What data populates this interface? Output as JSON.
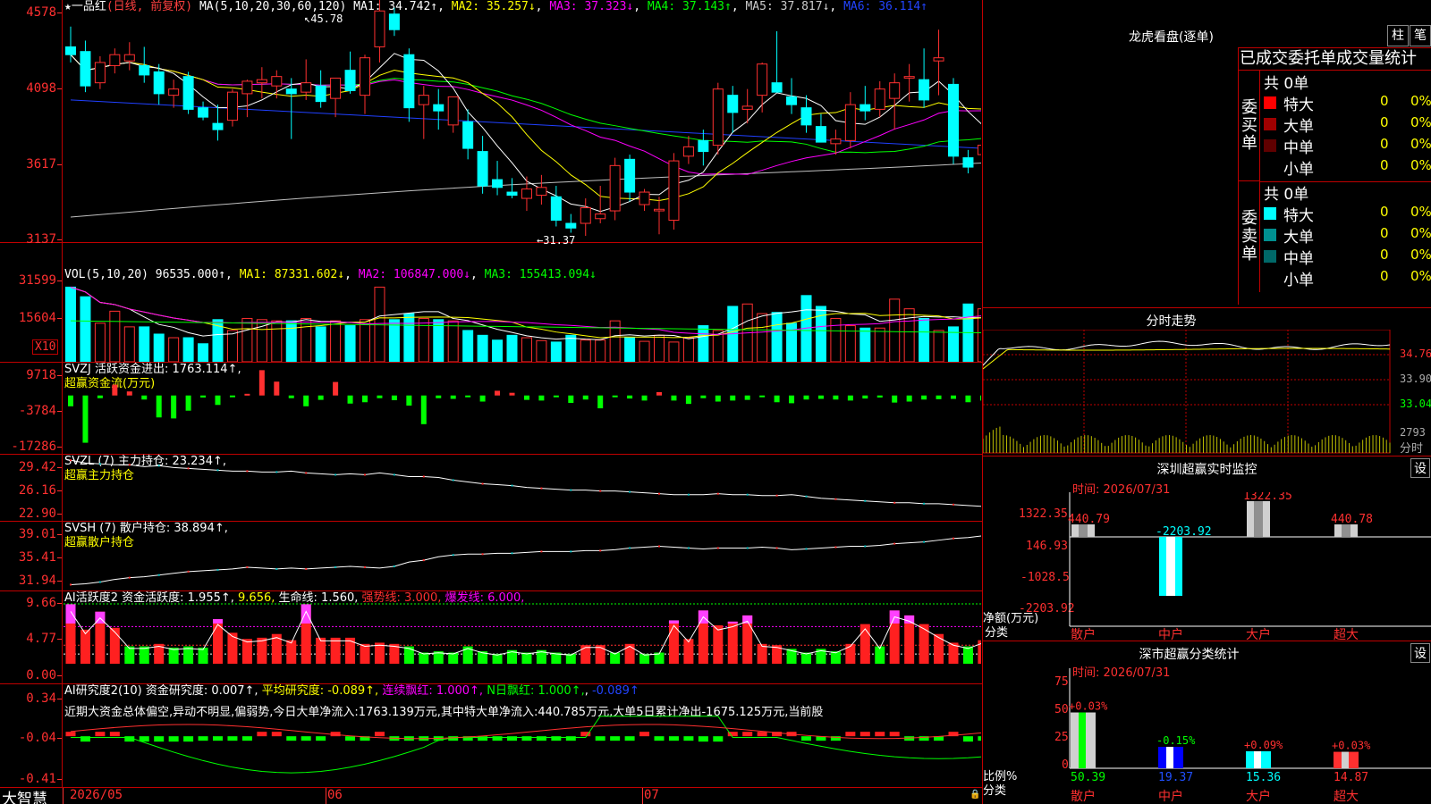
{
  "chart_header": {
    "title": "★一品红",
    "mode": "(日线, 前复权)",
    "ma_params": "MA(5,10,20,30,60,120)",
    "ma": [
      {
        "label": "MA1: 34.742↑",
        "color": "#ffffff"
      },
      {
        "label": "MA2: 35.257↓",
        "color": "#ffff00"
      },
      {
        "label": "MA3: 37.323↓",
        "color": "#ff00ff"
      },
      {
        "label": "MA4: 37.143↑",
        "color": "#00ff00"
      },
      {
        "label": "MA5: 37.817↓",
        "color": "#c0c0c0"
      },
      {
        "label": "MA6: 36.114↑",
        "color": "#0000ff"
      }
    ],
    "high_mark": "45.78",
    "low_mark": "←31.37"
  },
  "price_axis": [
    "4578",
    "4098",
    "3617",
    "3137"
  ],
  "vol_panel": {
    "header": "VOL(5,10,20)",
    "value": "96535.000↑",
    "ma1": "MA1: 87331.602↓",
    "ma2": "MA2: 106847.000↓",
    "ma3": "MA3: 155413.094↓",
    "axis": [
      "31599",
      "15604"
    ],
    "unit": "X10"
  },
  "svzj_panel": {
    "header": "SVZJ  活跃资金进出: 1763.114↑,",
    "sub": "超赢资金流(万元)",
    "axis": [
      "9718",
      "-3784",
      "-17286"
    ]
  },
  "svzl_panel": {
    "header": "SVZL (7) 主力持仓: 23.234↑,",
    "sub": "超赢主力持仓",
    "axis": [
      "29.42",
      "26.16",
      "22.90"
    ]
  },
  "svsh_panel": {
    "header": "SVSH (7) 散户持仓: 38.894↑,",
    "sub": "超赢散户持仓",
    "axis": [
      "39.01",
      "35.41",
      "31.94"
    ]
  },
  "ai_active_panel": {
    "header": "AI活跃度2 资金活跃度: 1.955↑,",
    "v2": "9.656,",
    "life": "生命线: 1.560,",
    "strong": "强势线: 3.000,",
    "burst": "爆发线: 6.000,",
    "axis": [
      "9.66",
      "4.77",
      "0.00"
    ]
  },
  "ai_research_panel": {
    "header": "AI研究度2(10) 资金研究度: 0.007↑,",
    "avg": "平均研究度: -0.089↑,",
    "cont": "连续飘红: 1.000↑,",
    "nday": "N日飘红: 1.000↑,",
    "neg": "-0.089↑",
    "axis": [
      "0.34",
      "-0.04",
      "-0.41"
    ],
    "note": "近期大资金总体偏空,异动不明显,偏弱势,今日大单净流入:1763.139万元,其中特大单净流入:440.785万元,大单5日累计净出-1675.125万元,当前股"
  },
  "xaxis": {
    "labels": [
      "2026/05",
      "06",
      "07"
    ],
    "brand": "大智慧"
  },
  "right": {
    "dragon_title": "龙虎看盘(逐单)",
    "btn_bar": "柱",
    "btn_pen": "笔",
    "tabs": "已成交委托单成交量统计",
    "buy_label": "委买单",
    "sell_label": "委卖单",
    "buy_total": "共 0单",
    "sell_total": "共 0单",
    "buy_rows": [
      {
        "name": "特大",
        "count": "0",
        "pct": "0%",
        "color": "#ff0000"
      },
      {
        "name": "大单",
        "count": "0",
        "pct": "0%",
        "color": "#a00000"
      },
      {
        "name": "中单",
        "count": "0",
        "pct": "0%",
        "color": "#600000"
      },
      {
        "name": "小单",
        "count": "0",
        "pct": "0%",
        "color": "#000000"
      }
    ],
    "sell_rows": [
      {
        "name": "特大",
        "count": "0",
        "pct": "0%",
        "color": "#00ffff"
      },
      {
        "name": "大单",
        "count": "0",
        "pct": "0%",
        "color": "#009090"
      },
      {
        "name": "中单",
        "count": "0",
        "pct": "0%",
        "color": "#006868"
      },
      {
        "name": "小单",
        "count": "0",
        "pct": "0%",
        "color": "#000000"
      }
    ],
    "intraday_title": "分时走势",
    "intraday_axis": [
      "34.76",
      "33.90",
      "33.04",
      "2793",
      "分时"
    ],
    "sz_monitor": {
      "title": "深圳超赢实时监控",
      "settings": "设",
      "time": "时间: 2026/07/31",
      "axis": [
        "1322.35",
        "146.93",
        "-1028.5",
        "-2203.92"
      ],
      "ylabel": "净额(万元)",
      "xlabel": "分类",
      "bars": [
        {
          "name": "散户",
          "value": 440.79,
          "label": "440.79"
        },
        {
          "name": "中户",
          "value": -2203.92,
          "label": "-2203.92"
        },
        {
          "name": "大户",
          "value": 1322.35,
          "label": "1322.35"
        },
        {
          "name": "超大",
          "value": 440.78,
          "label": "440.78"
        }
      ]
    },
    "sz_classify": {
      "title": "深市超赢分类统计",
      "settings": "设",
      "time": "时间: 2026/07/31",
      "axis": [
        "75",
        "50",
        "25",
        "0"
      ],
      "ylabel": "比例%",
      "xlabel": "分类",
      "bars": [
        {
          "name": "散户",
          "value": 50.39,
          "label": "50.39",
          "change": "+0.03%"
        },
        {
          "name": "中户",
          "value": 19.37,
          "label": "19.37",
          "change": "-0.15%"
        },
        {
          "name": "大户",
          "value": 15.36,
          "label": "15.36",
          "change": "+0.09%"
        },
        {
          "name": "超大",
          "value": 14.87,
          "label": "14.87",
          "change": "+0.03%"
        }
      ]
    }
  },
  "chart_data": [
    {
      "type": "candlestick",
      "title": "一品红 日线 前复权",
      "ylim": [
        31.0,
        46.5
      ],
      "candles": [
        [
          43.5,
          44.8,
          42.5,
          43.0
        ],
        [
          43.2,
          43.9,
          40.6,
          41.0
        ],
        [
          41.2,
          42.9,
          40.8,
          42.5
        ],
        [
          42.3,
          43.4,
          41.8,
          43.0
        ],
        [
          42.6,
          43.8,
          42.0,
          43.0
        ],
        [
          42.3,
          43.5,
          41.2,
          41.7
        ],
        [
          41.9,
          42.4,
          39.8,
          40.5
        ],
        [
          40.4,
          41.4,
          39.6,
          40.8
        ],
        [
          41.6,
          41.9,
          39.2,
          39.5
        ],
        [
          39.6,
          40.0,
          38.8,
          39.0
        ],
        [
          38.6,
          39.8,
          37.5,
          38.2
        ],
        [
          38.8,
          40.8,
          38.4,
          40.6
        ],
        [
          40.5,
          41.4,
          39.0,
          41.3
        ],
        [
          41.2,
          42.2,
          40.2,
          41.4
        ],
        [
          41.0,
          42.0,
          40.2,
          41.6
        ],
        [
          40.8,
          41.5,
          37.6,
          40.5
        ],
        [
          40.6,
          42.7,
          40.1,
          41.2
        ],
        [
          41.0,
          42.0,
          39.6,
          40.0
        ],
        [
          40.2,
          41.5,
          39.0,
          41.5
        ],
        [
          42.0,
          43.2,
          40.5,
          40.7
        ],
        [
          40.4,
          43.0,
          39.2,
          42.8
        ],
        [
          43.5,
          46.6,
          42.5,
          45.8
        ],
        [
          45.6,
          46.0,
          44.2,
          44.6
        ],
        [
          43.0,
          43.4,
          38.7,
          39.6
        ],
        [
          39.8,
          41.0,
          37.6,
          40.4
        ],
        [
          39.8,
          40.8,
          38.2,
          39.4
        ],
        [
          38.5,
          40.2,
          38.0,
          40.3
        ],
        [
          38.7,
          39.5,
          36.3,
          37.0
        ],
        [
          36.8,
          37.8,
          34.1,
          34.6
        ],
        [
          35.0,
          36.2,
          34.0,
          34.5
        ],
        [
          34.2,
          35.1,
          33.8,
          34.0
        ],
        [
          33.8,
          35.2,
          33.0,
          34.4
        ],
        [
          34.0,
          35.3,
          33.4,
          34.5
        ],
        [
          33.9,
          34.6,
          32.0,
          32.4
        ],
        [
          32.2,
          32.8,
          31.6,
          31.9
        ],
        [
          32.2,
          33.8,
          31.4,
          33.2
        ],
        [
          32.5,
          34.6,
          32.2,
          32.8
        ],
        [
          33.0,
          36.4,
          32.4,
          35.9
        ],
        [
          36.3,
          36.6,
          33.6,
          34.2
        ],
        [
          33.4,
          34.4,
          33.0,
          34.2
        ],
        [
          33.0,
          33.9,
          31.5,
          33.1
        ],
        [
          32.4,
          36.7,
          31.8,
          36.2
        ],
        [
          36.5,
          37.8,
          36.0,
          37.1
        ],
        [
          37.5,
          38.2,
          35.9,
          36.8
        ],
        [
          37.2,
          41.2,
          36.6,
          40.8
        ],
        [
          40.4,
          41.0,
          38.0,
          39.3
        ],
        [
          39.5,
          40.8,
          38.6,
          39.7
        ],
        [
          40.4,
          42.5,
          39.3,
          42.4
        ],
        [
          41.2,
          44.5,
          41.0,
          40.6
        ],
        [
          40.3,
          41.5,
          39.2,
          39.8
        ],
        [
          39.6,
          40.4,
          38.0,
          38.5
        ],
        [
          38.4,
          39.2,
          37.7,
          37.4
        ],
        [
          37.3,
          38.2,
          36.6,
          37.6
        ],
        [
          37.5,
          40.6,
          37.0,
          39.8
        ],
        [
          39.8,
          41.0,
          38.8,
          39.4
        ],
        [
          39.5,
          41.3,
          39.0,
          40.8
        ],
        [
          40.2,
          41.8,
          38.2,
          41.2
        ],
        [
          41.5,
          42.4,
          40.0,
          41.6
        ],
        [
          41.4,
          43.4,
          39.6,
          40.1
        ],
        [
          42.6,
          44.6,
          40.4,
          42.8
        ],
        [
          41.1,
          41.5,
          36.0,
          36.5
        ],
        [
          36.4,
          36.9,
          35.4,
          35.8
        ],
        [
          36.6,
          37.4,
          34.5,
          37.2
        ],
        [
          36.4,
          37.5,
          35.8,
          36.8
        ],
        [
          36.0,
          36.4,
          35.6,
          36.2
        ],
        [
          35.8,
          36.6,
          34.6,
          34.8
        ],
        [
          35.4,
          35.8,
          33.6,
          33.3
        ],
        [
          33.4,
          35.0,
          33.1,
          34.8
        ],
        [
          34.5,
          34.9,
          33.8,
          34.0
        ],
        [
          34.6,
          35.1,
          34.1,
          34.6
        ],
        [
          34.4,
          34.6,
          33.2,
          33.5
        ],
        [
          34.1,
          35.6,
          33.3,
          35.2
        ]
      ]
    },
    {
      "type": "bar",
      "title": "VOL",
      "unit": "X10",
      "values": [
        31000,
        27000,
        16000,
        21000,
        14500,
        14500,
        11500,
        10000,
        10000,
        7500,
        17500,
        13000,
        18000,
        17500,
        17000,
        17000,
        18000,
        14500,
        17000,
        15000,
        17500,
        31000,
        17500,
        20000,
        18000,
        17500,
        17000,
        13000,
        11000,
        9000,
        11000,
        10000,
        8800,
        8200,
        11000,
        9000,
        9000,
        17000,
        10000,
        8500,
        11000,
        8200,
        10000,
        15000,
        13000,
        23000,
        24000,
        20000,
        20500,
        16000,
        27500,
        23000,
        18000,
        15000,
        14000,
        14000,
        26000,
        22000,
        18000,
        13000,
        14500,
        24000,
        22000,
        24500,
        13000,
        10000,
        8000,
        9000,
        10000,
        10000,
        8000,
        8000
      ]
    },
    {
      "type": "bar",
      "title": "超赢资金流(万元)",
      "ylim": [
        -17286,
        9718
      ],
      "values": [
        -3200,
        -14000,
        -800,
        3200,
        1200,
        -1200,
        -6500,
        -6800,
        -4500,
        -600,
        -2800,
        -500,
        500,
        7500,
        4100,
        -800,
        -3200,
        -1300,
        4000,
        -2400,
        -2000,
        -800,
        -1400,
        -3000,
        -8500,
        -800,
        -1000,
        -500,
        -1800,
        1400,
        800,
        -1300,
        -1500,
        -500,
        -2200,
        -1200,
        -3800,
        -500,
        -900,
        -1500,
        1000,
        -1500,
        -2500,
        -800,
        -1800,
        -1500,
        -1300,
        -500,
        -2000,
        -2300,
        -1200,
        -1000,
        -1200,
        -1500,
        -900,
        -600,
        -2100,
        -1800,
        -1200,
        -1100,
        -1000,
        -2000,
        -1500,
        -900,
        -700,
        -1500,
        -1700,
        -1100,
        -1500,
        -1300,
        -2400,
        -1100
      ]
    },
    {
      "type": "line",
      "title": "超赢主力持仓",
      "ylim": [
        22.9,
        29.42
      ],
      "values": [
        29.2,
        28.9,
        28.8,
        28.7,
        28.7,
        28.5,
        28.6,
        28.4,
        28.3,
        28.2,
        28.1,
        28.0,
        28.0,
        27.9,
        27.9,
        28.0,
        27.8,
        27.7,
        27.6,
        27.7,
        27.6,
        27.8,
        27.6,
        27.4,
        27.4,
        27.3,
        27.0,
        26.8,
        26.6,
        26.5,
        26.4,
        26.2,
        26.1,
        26.0,
        25.9,
        25.9,
        25.8,
        25.8,
        25.7,
        25.6,
        25.5,
        25.4,
        25.4,
        25.4,
        25.5,
        25.4,
        25.4,
        25.3,
        25.3,
        25.4,
        25.2,
        25.0,
        24.9,
        24.8,
        24.7,
        24.6,
        24.5,
        24.5,
        24.4,
        24.4,
        24.3,
        24.2,
        24.1,
        24.0,
        23.9,
        23.8,
        23.7,
        23.6,
        23.5,
        23.4,
        23.3,
        23.2
      ]
    },
    {
      "type": "line",
      "title": "超赢散户持仓",
      "ylim": [
        31.94,
        39.01
      ],
      "values": [
        32.2,
        32.3,
        32.5,
        32.8,
        33.0,
        33.1,
        33.3,
        33.5,
        33.7,
        33.8,
        33.9,
        34.0,
        34.2,
        34.1,
        34.0,
        34.1,
        34.0,
        34.1,
        34.2,
        34.3,
        34.2,
        34.1,
        34.3,
        34.8,
        35.0,
        35.4,
        35.6,
        35.7,
        35.7,
        35.8,
        35.8,
        35.9,
        36.0,
        36.0,
        36.0,
        36.1,
        36.1,
        36.2,
        36.4,
        36.5,
        36.6,
        36.5,
        36.4,
        36.3,
        36.4,
        36.4,
        36.4,
        36.5,
        36.4,
        36.2,
        36.3,
        36.4,
        36.5,
        36.6,
        36.6,
        36.7,
        36.9,
        37.0,
        37.1,
        37.3,
        37.5,
        37.6,
        37.8,
        38.0,
        38.1,
        38.2,
        38.3,
        38.4,
        38.5,
        38.6,
        38.7,
        38.9
      ]
    },
    {
      "type": "bar",
      "title": "AI活跃度2",
      "ylim": [
        0,
        9.66
      ],
      "values": [
        9.6,
        5.5,
        8.4,
        5.8,
        2.8,
        2.8,
        3.2,
        2.6,
        2.8,
        2.6,
        7.2,
        5.0,
        4.0,
        4.2,
        4.8,
        3.8,
        9.6,
        4.2,
        4.2,
        4.2,
        3.2,
        3.4,
        3.2,
        2.8,
        1.8,
        2.0,
        1.8,
        2.8,
        2.0,
        1.6,
        2.2,
        1.8,
        2.2,
        1.8,
        1.6,
        3.0,
        3.0,
        1.8,
        3.2,
        1.6,
        1.8,
        7.0,
        4.0,
        8.6,
        6.2,
        6.8,
        7.8,
        3.2,
        3.0,
        2.4,
        1.8,
        2.4,
        2.0,
        3.2,
        6.4,
        2.8,
        8.6,
        7.8,
        6.4,
        4.8,
        3.4,
        2.8,
        3.8,
        3.0,
        2.4,
        1.8,
        1.6,
        1.4,
        1.6,
        1.8,
        1.4,
        2.0
      ]
    },
    {
      "type": "bar",
      "title": "AI研究度2(10)",
      "ylim": [
        -0.41,
        0.34
      ],
      "values": [
        0.02,
        -0.05,
        0.04,
        0.04,
        -0.05,
        -0.05,
        -0.05,
        -0.05,
        -0.05,
        -0.03,
        -0.03,
        -0.03,
        -0.04,
        0.03,
        0.02,
        -0.03,
        -0.04,
        -0.04,
        0.03,
        -0.03,
        -0.03,
        0.04,
        -0.04,
        -0.03,
        -0.03,
        -0.04,
        -0.04,
        -0.04,
        -0.03,
        -0.03,
        -0.03,
        -0.03,
        -0.03,
        -0.03,
        -0.04,
        0.02,
        -0.04,
        -0.04,
        -0.03,
        0.02,
        -0.03,
        -0.03,
        -0.04,
        -0.05,
        -0.05,
        0.03,
        0.03,
        0.03,
        0.04,
        0.04,
        -0.04,
        -0.03,
        -0.03,
        0.02,
        0.03,
        0.02,
        0.02,
        -0.03,
        -0.03,
        -0.03,
        0.03,
        -0.05,
        -0.04,
        -0.05,
        -0.05,
        -0.04,
        -0.04,
        -0.05,
        -0.04,
        -0.04,
        -0.05,
        -0.06
      ]
    }
  ]
}
